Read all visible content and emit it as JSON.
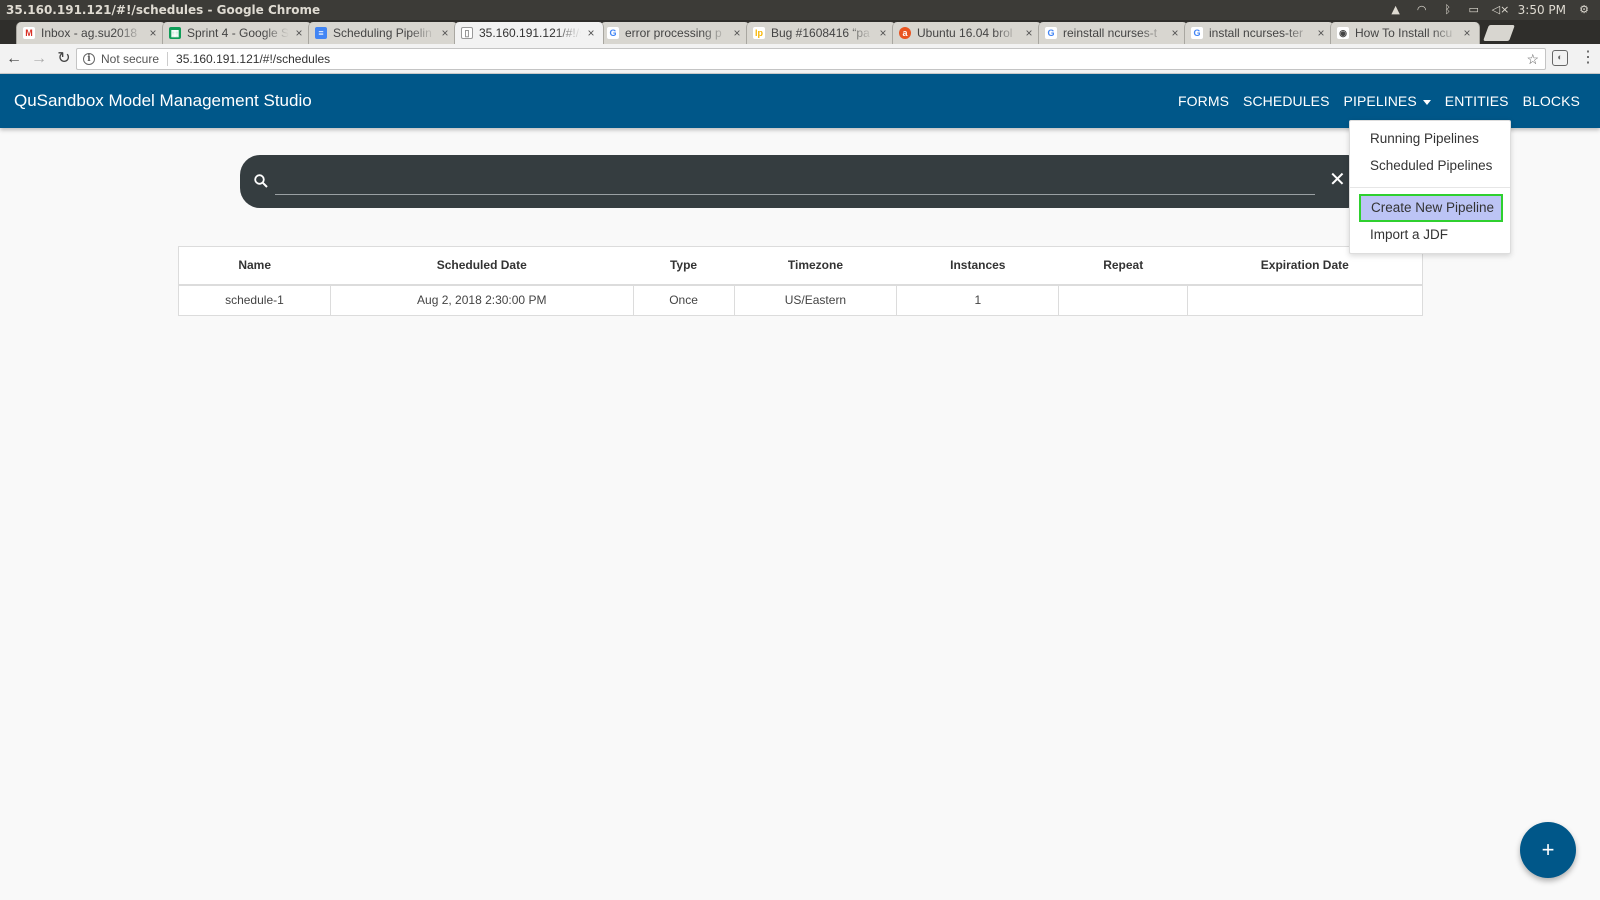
{
  "window": {
    "title": "35.160.191.121/#!/schedules - Google Chrome",
    "clock": "3:50 PM"
  },
  "tabs": [
    {
      "title": "Inbox - ag.su2018",
      "favicon": "gmail-icon",
      "color": "#d93025",
      "glyph": "M"
    },
    {
      "title": "Sprint 4 - Google S",
      "favicon": "sheets-icon",
      "color": "#0f9d58",
      "glyph": "▦"
    },
    {
      "title": "Scheduling Pipelin",
      "favicon": "docs-icon",
      "color": "#4285f4",
      "glyph": "≡"
    },
    {
      "title": "35.160.191.121/#!/s",
      "favicon": "page-icon",
      "color": "#888888",
      "glyph": "▯",
      "active": true
    },
    {
      "title": "error processing p",
      "favicon": "google-icon",
      "color": "#4285f4",
      "glyph": "G"
    },
    {
      "title": "Bug #1608416 “pa",
      "favicon": "launchpad-icon",
      "color": "#f7b500",
      "glyph": "lp"
    },
    {
      "title": "Ubuntu 16.04 brol",
      "favicon": "askubuntu-icon",
      "color": "#e95420",
      "glyph": "a"
    },
    {
      "title": "reinstall ncurses-t",
      "favicon": "google-icon",
      "color": "#4285f4",
      "glyph": "G"
    },
    {
      "title": "install ncurses-ter",
      "favicon": "google-icon",
      "color": "#4285f4",
      "glyph": "G"
    },
    {
      "title": "How To Install ncu",
      "favicon": "site-icon",
      "color": "#444444",
      "glyph": "◉"
    }
  ],
  "address": {
    "security_label": "Not secure",
    "url": "35.160.191.121/#!/schedules"
  },
  "app": {
    "brand": "QuSandbox Model Management Studio",
    "brand_color": "#005789",
    "nav": {
      "forms": "FORMS",
      "schedules": "SCHEDULES",
      "pipelines": "PIPELINES",
      "entities": "ENTITIES",
      "blocks": "BLOCKS"
    }
  },
  "dropdown": {
    "running": "Running Pipelines",
    "scheduled": "Scheduled Pipelines",
    "create": "Create New Pipeline",
    "import": "Import a JDF"
  },
  "search": {
    "value": "",
    "placeholder": ""
  },
  "table": {
    "headers": [
      "Name",
      "Scheduled Date",
      "Type",
      "Timezone",
      "Instances",
      "Repeat",
      "Expiration Date"
    ],
    "rows": [
      [
        "schedule-1",
        "Aug 2, 2018 2:30:00 PM",
        "Once",
        "US/Eastern",
        "1",
        "",
        ""
      ]
    ]
  },
  "fab": {
    "label": "+"
  }
}
